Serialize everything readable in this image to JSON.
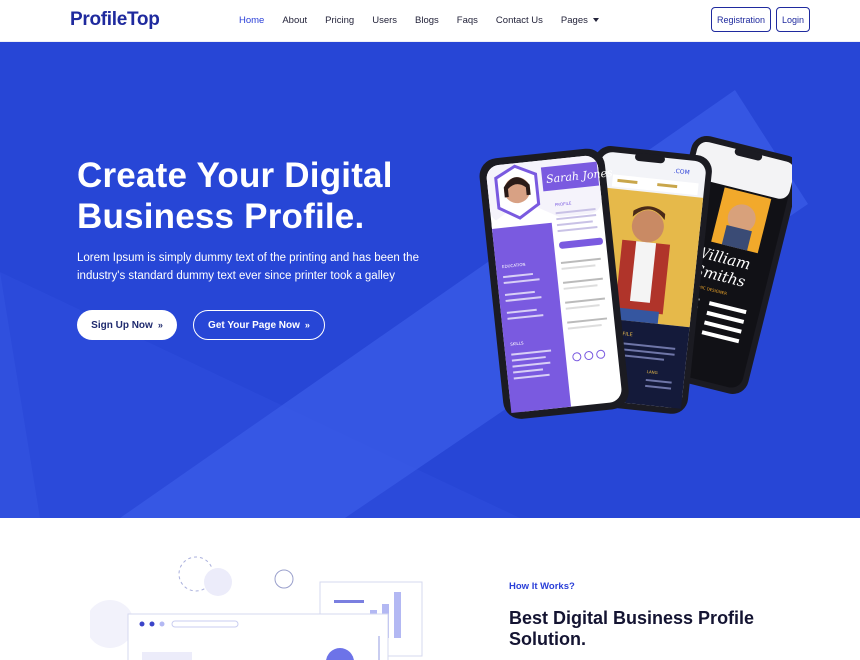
{
  "brand": {
    "name": "ProfileTop"
  },
  "nav": {
    "items": [
      {
        "label": "Home",
        "active": true
      },
      {
        "label": "About"
      },
      {
        "label": "Pricing"
      },
      {
        "label": "Users"
      },
      {
        "label": "Blogs"
      },
      {
        "label": "Faqs"
      },
      {
        "label": "Contact Us"
      },
      {
        "label": "Pages",
        "dropdown": true
      }
    ],
    "registration": "Registration",
    "login": "Login"
  },
  "hero": {
    "title_line1": "Create Your Digital",
    "title_line2": "Business Profile.",
    "description": "Lorem Ipsum is simply dummy text of the printing and has been the industry's standard dummy text ever since printer took a galley",
    "primary_button": "Sign Up Now",
    "secondary_button": "Get Your Page Now",
    "button_arrow": "»"
  },
  "phones": {
    "left_name": "Sarah Jones",
    "left_section": "PROFILE",
    "left_education": "EDUCATION",
    "left_skills": "SKILLS",
    "middle_header": ".COM",
    "middle_section": "ONAL PROFILE",
    "middle_lang": "LANG",
    "right_name_line1": "William",
    "right_name_line2": "Smiths",
    "right_role": "GRAPHIC DESIGNER"
  },
  "how": {
    "label": "How It Works?",
    "title": "Best Digital Business Profile Solution."
  },
  "colors": {
    "brand": "#1f2a9e",
    "hero_bg": "#2746d6",
    "accent": "#2a3fd8",
    "phone_purple": "#7a5ae0"
  }
}
